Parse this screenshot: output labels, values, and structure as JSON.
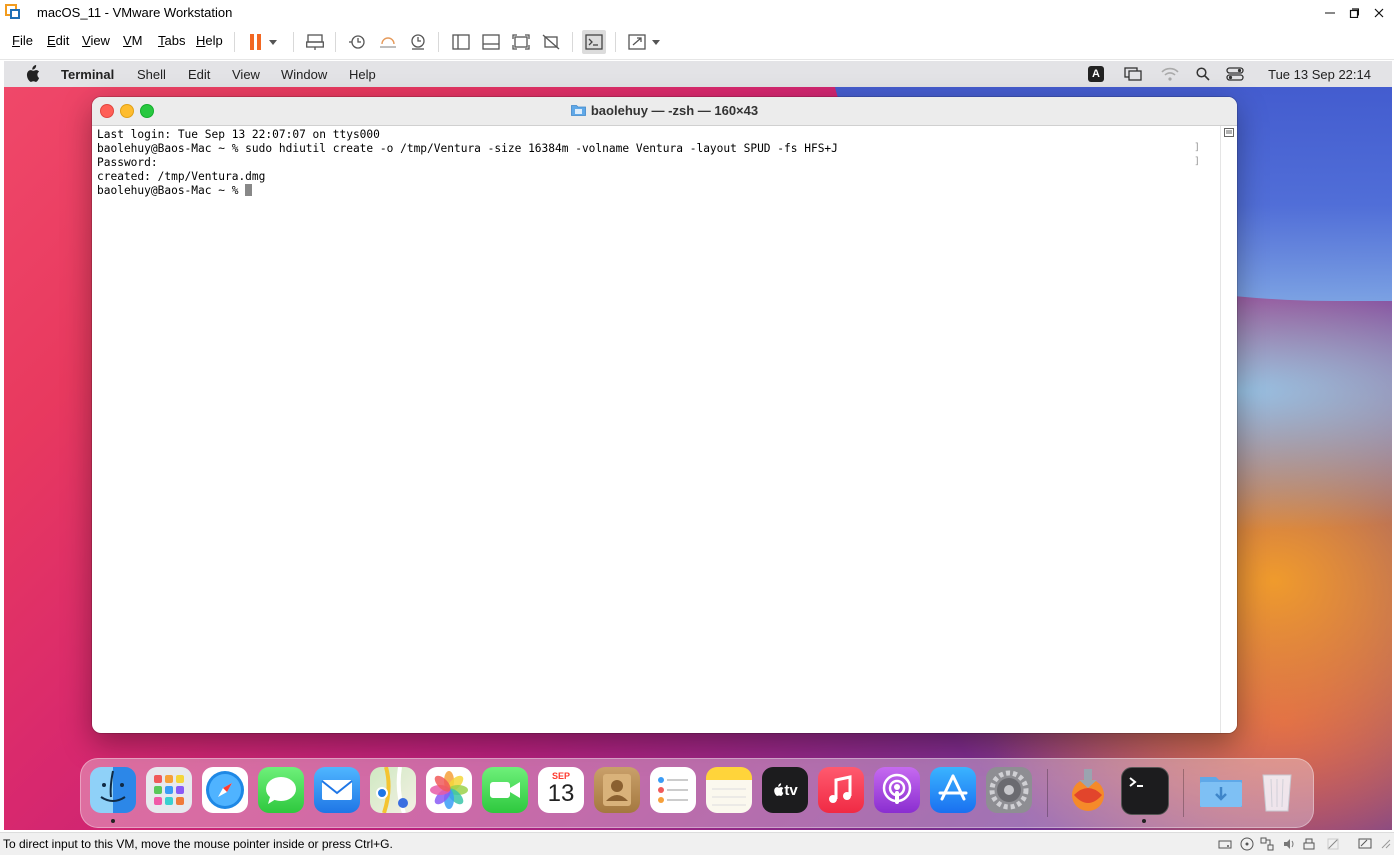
{
  "window": {
    "title": "macOS_11 - VMware Workstation",
    "minimize_icon": "minimize-icon",
    "maximize_icon": "maximize-icon",
    "close_icon": "close-icon"
  },
  "vmware_menu": [
    "File",
    "Edit",
    "View",
    "VM",
    "Tabs",
    "Help"
  ],
  "vmware_toolbar_icons": [
    "pause-icon",
    "dropdown-icon",
    "send-ctrl-alt-del-icon",
    "snapshot-icon",
    "revert-snapshot-icon",
    "snapshot-manager-icon",
    "library-icon",
    "thumbnail-bar-icon",
    "full-screen-icon",
    "unity-icon",
    "console-view-icon",
    "stretch-guest-icon",
    "dropdown-icon"
  ],
  "mac_menubar": {
    "app_name": "Terminal",
    "items": [
      "Shell",
      "Edit",
      "View",
      "Window",
      "Help"
    ],
    "input_source": "A",
    "clock": "Tue 13 Sep  22:14",
    "status_icons": [
      "input-source-icon",
      "screen-mirroring-icon",
      "wifi-icon",
      "spotlight-icon",
      "control-center-icon"
    ]
  },
  "terminal": {
    "title": "baolehuy — -zsh — 160×43",
    "lines": [
      "Last login: Tue Sep 13 22:07:07 on ttys000",
      "baolehuy@Baos-Mac ~ % sudo hdiutil create -o /tmp/Ventura -size 16384m -volname Ventura -layout SPUD -fs HFS+J",
      "Password:",
      "created: /tmp/Ventura.dmg",
      "baolehuy@Baos-Mac ~ % "
    ]
  },
  "dock": {
    "apps": [
      "Finder",
      "Launchpad",
      "Safari",
      "Messages",
      "Mail",
      "Maps",
      "Photos",
      "FaceTime",
      "Calendar",
      "Contacts",
      "Reminders",
      "Notes",
      "TV",
      "Music",
      "Podcasts",
      "App Store",
      "System Preferences",
      "Install macOS Ventura",
      "Terminal",
      "Downloads",
      "Trash"
    ],
    "calendar_month": "SEP",
    "calendar_day": "13",
    "tv_label": "tv"
  },
  "status_bar": {
    "text": "To direct input to this VM, move the mouse pointer inside or press Ctrl+G."
  },
  "colors": {
    "terminal_bg": "#ffffff",
    "traffic_red": "#ff5f57",
    "traffic_yellow": "#febc2e",
    "traffic_green": "#28c840",
    "vmware_pause": "#f26722"
  }
}
